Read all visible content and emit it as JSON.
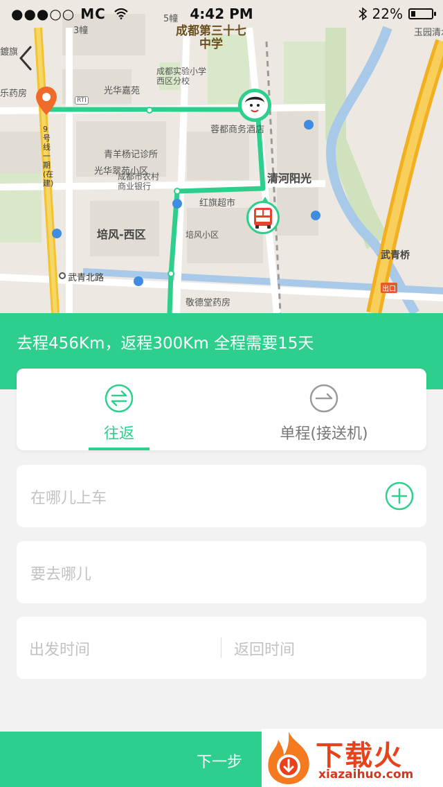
{
  "status_bar": {
    "carrier": "●●●○○ MC",
    "time": "4:42 PM",
    "battery": "22%",
    "battery_level": 0.22
  },
  "map": {
    "labels": {
      "school": "成都第三十七\n中学",
      "qinghe": "清河阳光",
      "peifeng": "培风-西区",
      "wuqing_bridge": "武青桥",
      "wuqing_north_rd": "武青北路",
      "hongqi": "红旗超市",
      "bank": "成都市农村\n商业银行",
      "primary_school": "成都实验小学\n西区分校",
      "guanghua_jiayuan": "光华嘉苑",
      "guanghua_yuan": "光华翠苑小区",
      "clinic": "青羊杨记诊所",
      "pharmacy_right": "敬德堂药房",
      "rongdu": "蓉都商务酒店",
      "building3": "3幢",
      "building5": "5幢",
      "yuyuan": "玉园清水",
      "pharmacy_left": "乐药房",
      "ganqi": "鍍旗",
      "exit": "出口",
      "line9": "9号线一期(在建)",
      "peixiaoqu": "培风小区",
      "rti": "RTI"
    }
  },
  "summary": "去程456Km，返程300Km  全程需要15天",
  "tabs": [
    {
      "label": "往返",
      "icon": "round-trip-icon",
      "active": true
    },
    {
      "label": "单程(接送机)",
      "icon": "one-way-icon",
      "active": false
    }
  ],
  "form": {
    "pickup_placeholder": "在哪儿上车",
    "destination_placeholder": "要去哪儿",
    "depart_placeholder": "出发时间",
    "return_placeholder": "返回时间"
  },
  "next_button": "下一步",
  "watermark": {
    "title": "下载火",
    "url": "xiazaihuo.com"
  },
  "colors": {
    "accent": "#2ecf8c",
    "pin": "#f06a2b",
    "bus": "#e8432f"
  }
}
